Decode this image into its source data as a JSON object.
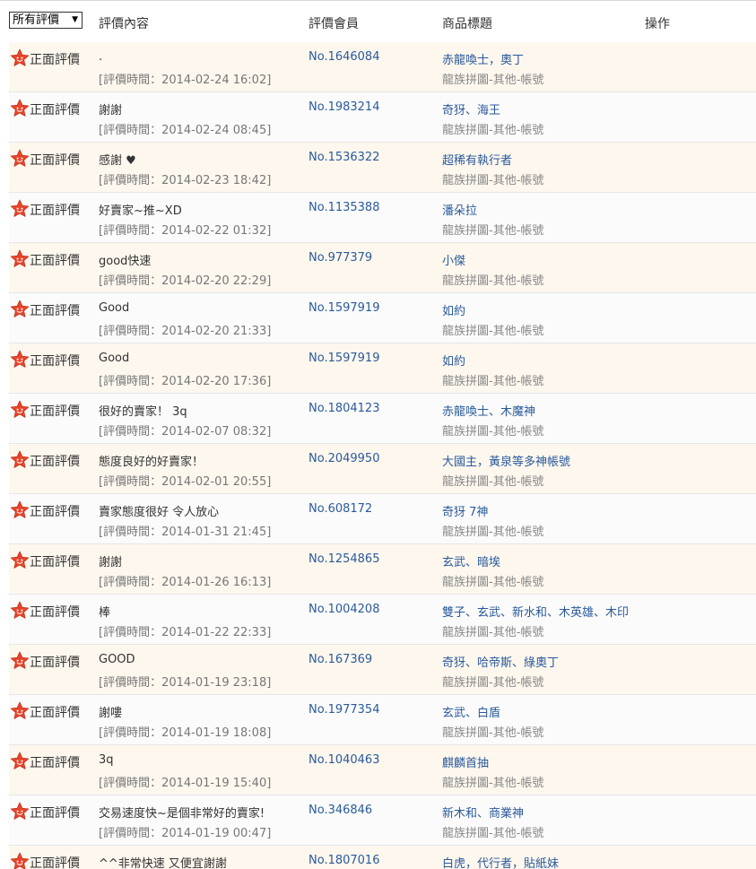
{
  "filter": {
    "selected": "所有評價"
  },
  "headers": {
    "content": "評價內容",
    "member": "評價會員",
    "title": "商品標題",
    "action": "操作"
  },
  "colors": {
    "badge": "#e8452c",
    "link": "#2a5a9b"
  },
  "rows": [
    {
      "type": "正面評價",
      "content": ".",
      "time": "[評價時間：2014-02-24 16:02]",
      "member": "No.1646084",
      "title": "赤龍喚士，奧丁",
      "category": "龍族拼圖-其他-帳號"
    },
    {
      "type": "正面評價",
      "content": "謝謝",
      "time": "[評價時間：2014-02-24 08:45]",
      "member": "No.1983214",
      "title": "奇犽、海王",
      "category": "龍族拼圖-其他-帳號"
    },
    {
      "type": "正面評價",
      "content": "感謝 ♥",
      "time": "[評價時間：2014-02-23 18:42]",
      "member": "No.1536322",
      "title": "超稀有執行者",
      "category": "龍族拼圖-其他-帳號"
    },
    {
      "type": "正面評價",
      "content": "好賣家~推~XD",
      "time": "[評價時間：2014-02-22 01:32]",
      "member": "No.1135388",
      "title": "潘朵拉",
      "category": "龍族拼圖-其他-帳號"
    },
    {
      "type": "正面評價",
      "content": "good快速",
      "time": "[評價時間：2014-02-20 22:29]",
      "member": "No.977379",
      "title": "小傑",
      "category": "龍族拼圖-其他-帳號"
    },
    {
      "type": "正面評價",
      "content": "Good",
      "time": "[評價時間：2014-02-20 21:33]",
      "member": "No.1597919",
      "title": "如約",
      "category": "龍族拼圖-其他-帳號"
    },
    {
      "type": "正面評價",
      "content": "Good",
      "time": "[評價時間：2014-02-20 17:36]",
      "member": "No.1597919",
      "title": "如約",
      "category": "龍族拼圖-其他-帳號"
    },
    {
      "type": "正面評價",
      "content": "很好的賣家！ 3q",
      "time": "[評價時間：2014-02-07 08:32]",
      "member": "No.1804123",
      "title": "赤龍喚士、木魔神",
      "category": "龍族拼圖-其他-帳號"
    },
    {
      "type": "正面評價",
      "content": "態度良好的好賣家！",
      "time": "[評價時間：2014-02-01 20:55]",
      "member": "No.2049950",
      "title": "大國主，黃泉等多神帳號",
      "category": "龍族拼圖-其他-帳號"
    },
    {
      "type": "正面評價",
      "content": "賣家態度很好 令人放心",
      "time": "[評價時間：2014-01-31 21:45]",
      "member": "No.608172",
      "title": "奇犽 7神",
      "category": "龍族拼圖-其他-帳號"
    },
    {
      "type": "正面評價",
      "content": "謝謝",
      "time": "[評價時間：2014-01-26 16:13]",
      "member": "No.1254865",
      "title": "玄武、暗埃",
      "category": "龍族拼圖-其他-帳號"
    },
    {
      "type": "正面評價",
      "content": "棒",
      "time": "[評價時間：2014-01-22 22:33]",
      "member": "No.1004208",
      "title": "雙子、玄武、新水和、木英雄、木印",
      "category": "龍族拼圖-其他-帳號"
    },
    {
      "type": "正面評價",
      "content": "GOOD",
      "time": "[評價時間：2014-01-19 23:18]",
      "member": "No.167369",
      "title": "奇犽、哈帝斯、綠奧丁",
      "category": "龍族拼圖-其他-帳號"
    },
    {
      "type": "正面評價",
      "content": "謝嘍",
      "time": "[評價時間：2014-01-19 18:08]",
      "member": "No.1977354",
      "title": "玄武、白盾",
      "category": "龍族拼圖-其他-帳號"
    },
    {
      "type": "正面評價",
      "content": "3q",
      "time": "[評價時間：2014-01-19 15:40]",
      "member": "No.1040463",
      "title": "麒麟首抽",
      "category": "龍族拼圖-其他-帳號"
    },
    {
      "type": "正面評價",
      "content": "交易速度快~是個非常好的賣家!",
      "time": "[評價時間：2014-01-19 00:47]",
      "member": "No.346846",
      "title": "新木和、商業神",
      "category": "龍族拼圖-其他-帳號"
    },
    {
      "type": "正面評價",
      "content": "^^非常快速 又便宜謝謝",
      "time": "",
      "member": "No.1807016",
      "title": "白虎，代行者，貼紙妹",
      "category": ""
    }
  ]
}
